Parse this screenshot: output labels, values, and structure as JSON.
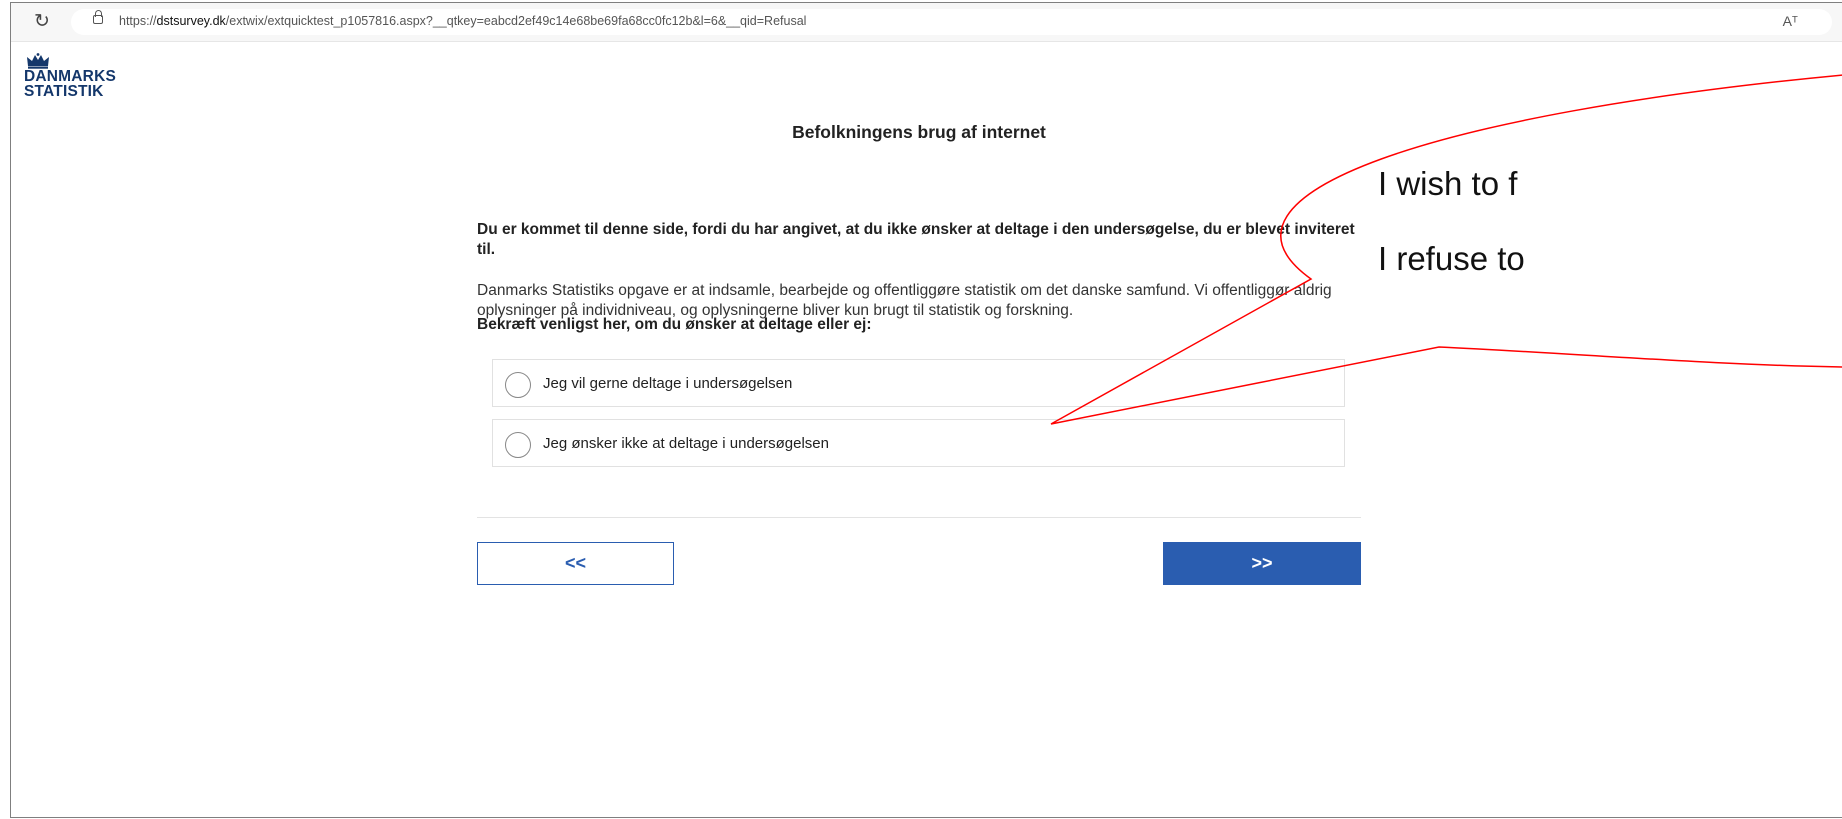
{
  "browser": {
    "url_prefix": "https://",
    "url_host": "dstsurvey.dk",
    "url_path": "/extwix/extquicktest_p1057816.aspx?__qtkey=eabcd2ef49c14e68be69fa68cc0fc12b&l=6&__qid=Refusal",
    "read_aloud_label": "Aᵀ"
  },
  "logo": {
    "line1": "DANMARKS",
    "line2": "STATISTIK"
  },
  "survey": {
    "title": "Befolkningens brug af internet",
    "intro_bold": "Du er kommet til denne side, fordi du har angivet, at du ikke ønsker at deltage i den undersøgelse, du er blevet inviteret til.",
    "intro_text": "Danmarks Statistiks opgave er at indsamle, bearbejde og offentliggøre statistik om det danske samfund. Vi offentliggør aldrig oplysninger på individniveau, og oplysningerne bliver kun brugt til statistik og forskning.",
    "question": "Bekræft venligst her, om du ønsker at deltage eller ej:",
    "options": [
      {
        "label": "Jeg vil gerne deltage i undersøgelsen",
        "selected": false
      },
      {
        "label": "Jeg ønsker ikke at deltage i undersøgelsen",
        "selected": false
      }
    ],
    "back_label": "<<",
    "next_label": ">>"
  },
  "annotation": {
    "line1": "I wish to f",
    "line2": "I refuse to",
    "color": "#ff0000"
  },
  "colors": {
    "accent": "#2a5db0",
    "logo": "#14376b"
  }
}
